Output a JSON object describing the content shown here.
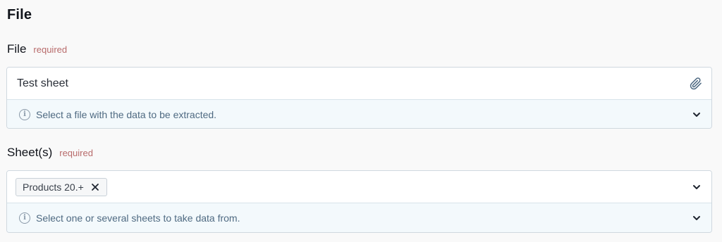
{
  "section": {
    "title": "File"
  },
  "file_field": {
    "label": "File",
    "required": "required",
    "value": "Test sheet",
    "hint": "Select a file with the data to be extracted."
  },
  "sheets_field": {
    "label": "Sheet(s)",
    "required": "required",
    "tags": [
      {
        "label": "Products 20.+"
      }
    ],
    "hint": "Select one or several sheets to take data from."
  },
  "icons": {
    "attach": "paperclip-icon",
    "info": "info-icon",
    "expand": "chevron-down-icon",
    "remove": "close-icon"
  },
  "colors": {
    "required": "#b86b6b",
    "hint_bg": "#f3f9fc",
    "hint_text": "#4f6a82"
  }
}
